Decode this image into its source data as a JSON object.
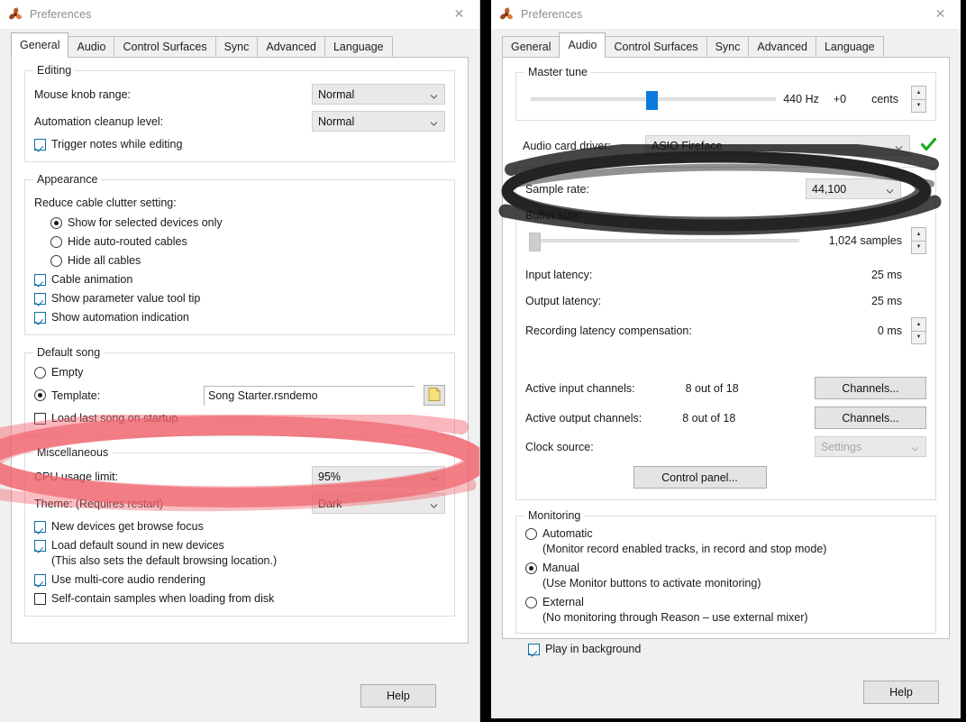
{
  "left_window": {
    "title": "Preferences",
    "app_icon": "reason-propeller-icon",
    "close_label": "✕",
    "tabs": [
      {
        "label": "General",
        "active": true
      },
      {
        "label": "Audio",
        "active": false
      },
      {
        "label": "Control Surfaces",
        "active": false
      },
      {
        "label": "Sync",
        "active": false
      },
      {
        "label": "Advanced",
        "active": false
      },
      {
        "label": "Language",
        "active": false
      }
    ],
    "editing": {
      "legend": "Editing",
      "mouse_knob_label": "Mouse knob range:",
      "mouse_knob_value": "Normal",
      "automation_label": "Automation cleanup level:",
      "automation_value": "Normal",
      "trigger_notes_label": "Trigger notes while editing"
    },
    "appearance": {
      "legend": "Appearance",
      "cable_clutter_label": "Reduce cable clutter setting:",
      "radio_show_selected": "Show for selected devices only",
      "radio_hide_auto": "Hide auto-routed cables",
      "radio_hide_all": "Hide all cables",
      "cable_animation": "Cable animation",
      "param_tooltip": "Show parameter value tool tip",
      "automation_indication": "Show automation indication"
    },
    "default_song": {
      "legend": "Default song",
      "radio_empty": "Empty",
      "radio_template": "Template:",
      "template_file": "Song Starter.rsndemo",
      "folder_icon": "folder-icon",
      "load_last_song": "Load last song on startup"
    },
    "miscellaneous": {
      "legend": "Miscellaneous",
      "cpu_label": "CPU usage limit:",
      "cpu_value": "95%",
      "theme_label": "Theme: (Requires restart)",
      "theme_value": "Dark",
      "browse_focus": "New devices get browse focus",
      "default_sound": "Load default sound in new devices",
      "default_sound_note": "(This also sets the default browsing location.)",
      "multicore": "Use multi-core audio rendering",
      "self_contain": "Self-contain samples when loading from disk"
    },
    "help_label": "Help"
  },
  "right_window": {
    "title": "Preferences",
    "app_icon": "reason-propeller-icon",
    "close_label": "✕",
    "tabs": [
      {
        "label": "General",
        "active": false
      },
      {
        "label": "Audio",
        "active": true
      },
      {
        "label": "Control Surfaces",
        "active": false
      },
      {
        "label": "Sync",
        "active": false
      },
      {
        "label": "Advanced",
        "active": false
      },
      {
        "label": "Language",
        "active": false
      }
    ],
    "master_tune": {
      "legend": "Master tune",
      "hz": "440 Hz",
      "cents_value": "+0",
      "cents_unit": "cents",
      "slider_percent": 50
    },
    "driver": {
      "label": "Audio card driver:",
      "value": "ASIO Fireface",
      "status_icon": "green-check-icon",
      "status_color": "#22a822"
    },
    "audio": {
      "sample_rate_label": "Sample rate:",
      "sample_rate_value": "44,100",
      "buffer_size_label": "Buffer size:",
      "buffer_size_value": "1,024 samples",
      "buffer_slider_percent": 2,
      "input_latency_label": "Input latency:",
      "input_latency_value": "25 ms",
      "output_latency_label": "Output latency:",
      "output_latency_value": "25 ms",
      "rec_latency_label": "Recording latency compensation:",
      "rec_latency_value": "0 ms",
      "active_in_label": "Active input channels:",
      "active_in_value": "8 out of 18",
      "active_out_label": "Active output channels:",
      "active_out_value": "8 out of 18",
      "channels_button_in": "Channels...",
      "channels_button_out": "Channels...",
      "clock_source_label": "Clock source:",
      "clock_source_value": "Settings",
      "control_panel_button": "Control panel..."
    },
    "monitoring": {
      "legend": "Monitoring",
      "automatic": "Automatic",
      "automatic_note": "(Monitor record enabled tracks, in record and stop mode)",
      "manual": "Manual",
      "manual_note": "(Use Monitor buttons to activate monitoring)",
      "external": "External",
      "external_note": "(No monitoring through Reason – use external mixer)",
      "play_in_background": "Play in background"
    },
    "help_label": "Help"
  },
  "annotations": {
    "red_ellipse": {
      "name": "red-highlight-ellipse",
      "color": "#f0616a"
    },
    "black_ellipse": {
      "name": "black-highlight-ellipse",
      "color": "#111111"
    }
  }
}
